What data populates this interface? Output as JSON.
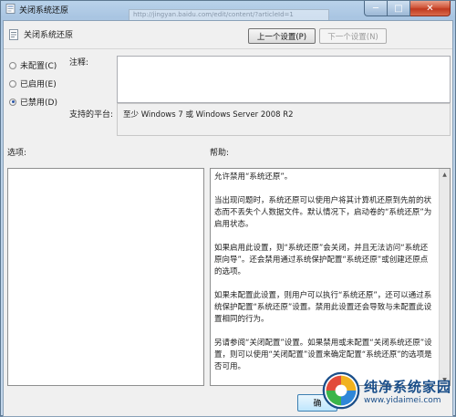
{
  "window": {
    "title": "关闭系统还原",
    "ghost_address": "http://jingyan.baidu.com/edit/content/?articleId=1",
    "controls": {
      "minimize": "─",
      "maximize": "□",
      "close": "✕"
    }
  },
  "header": {
    "policy_name": "关闭系统还原",
    "prev_button": "上一个设置(P)",
    "next_button": "下一个设置(N)"
  },
  "state_options": [
    {
      "label": "未配置(C)",
      "checked": false
    },
    {
      "label": "已启用(E)",
      "checked": false
    },
    {
      "label": "已禁用(D)",
      "checked": true
    }
  ],
  "comment": {
    "label": "注释:",
    "value": ""
  },
  "platform": {
    "label": "支持的平台:",
    "value": "至少 Windows 7 或 Windows Server 2008 R2"
  },
  "options": {
    "label": "选项:"
  },
  "help": {
    "label": "帮助:",
    "paragraphs": [
      "允许禁用“系统还原”。",
      "当出现问题时，系统还原可以使用户将其计算机还原到先前的状态而不丢失个人数据文件。默认情况下，启动卷的“系统还原”为启用状态。",
      "如果启用此设置，则“系统还原”会关闭，并且无法访问“系统还原向导”。还会禁用通过系统保护配置“系统还原”或创建还原点的选项。",
      "如果未配置此设置，则用户可以执行“系统还原”，还可以通过系统保护配置“系统还原”设置。禁用此设置还会导致与未配置此设置相同的行为。",
      "另请参阅“关闭配置”设置。如果禁用或未配置“关闭系统还原”设置，则可以使用“关闭配置”设置来确定配置“系统还原”的选项是否可用。"
    ]
  },
  "footer": {
    "ok_button": "确"
  },
  "watermark": {
    "name": "纯净系统家园",
    "url": "www.yidaimei.com"
  },
  "colors": {
    "accent": "#2a56a8",
    "watermark": "#1b4f8a"
  }
}
